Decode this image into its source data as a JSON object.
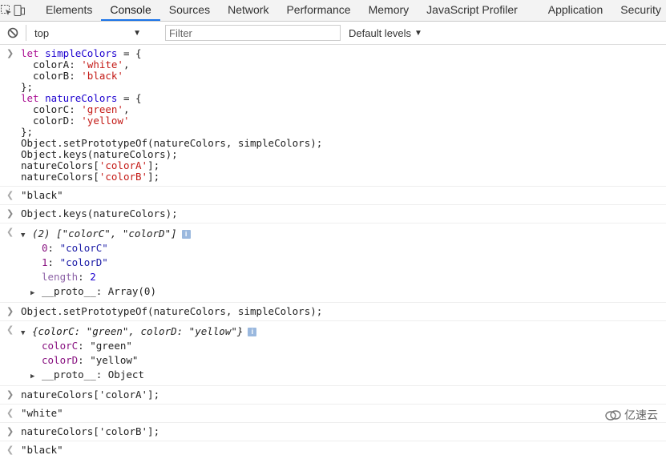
{
  "toolbar": {
    "tabs": [
      "Elements",
      "Console",
      "Sources",
      "Network",
      "Performance",
      "Memory",
      "JavaScript Profiler",
      "Application",
      "Security"
    ],
    "active_tab": "Console"
  },
  "console_toolbar": {
    "context": "top",
    "filter_placeholder": "Filter",
    "levels": "Default levels"
  },
  "entries": [
    {
      "input": [
        "let simpleColors = {",
        "  colorA: 'white',",
        "  colorB: 'black'",
        "};",
        "let natureColors = {",
        "  colorC: 'green',",
        "  colorD: 'yellow'",
        "};",
        "Object.setPrototypeOf(natureColors, simpleColors);",
        "Object.keys(natureColors);",
        "natureColors['colorA'];",
        "natureColors['colorB'];"
      ],
      "result": "\"black\""
    },
    {
      "input": "Object.keys(natureColors);",
      "result_summary": "(2) [\"colorC\", \"colorD\"]",
      "result_lines": [
        {
          "key": "0",
          "value": "\"colorC\""
        },
        {
          "key": "1",
          "value": "\"colorD\""
        },
        {
          "key": "length",
          "value": "2"
        }
      ],
      "proto": "__proto__: Array(0)"
    },
    {
      "input": "Object.setPrototypeOf(natureColors, simpleColors);",
      "result_summary": "{colorC: \"green\", colorD: \"yellow\"}",
      "result_lines": [
        {
          "key": "colorC",
          "value": "\"green\""
        },
        {
          "key": "colorD",
          "value": "\"yellow\""
        }
      ],
      "proto": "__proto__: Object"
    },
    {
      "input": "natureColors['colorA'];",
      "result": "\"white\""
    },
    {
      "input": "natureColors['colorB'];",
      "result": "\"black\""
    }
  ],
  "watermark": "亿速云",
  "colors": {
    "accent": "#1a73e8",
    "string": "#c41a16",
    "keyword": "#aa0d91"
  }
}
